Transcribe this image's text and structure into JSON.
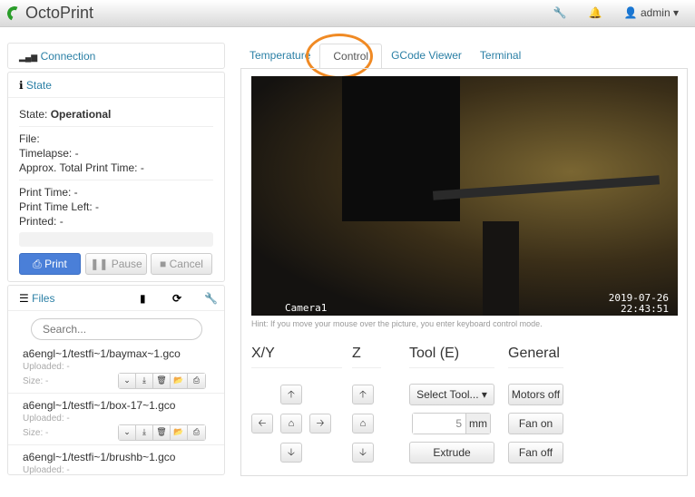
{
  "navbar": {
    "brand": "OctoPrint",
    "user": "admin"
  },
  "sidebar": {
    "connection": "Connection",
    "state": {
      "title": "State",
      "state_label": "State:",
      "state_value": "Operational",
      "file": "File:",
      "timelapse": "Timelapse: -",
      "approx": "Approx. Total Print Time: -",
      "print_time": "Print Time: -",
      "time_left": "Print Time Left: -",
      "printed": "Printed: -",
      "progress": 0,
      "print": "Print",
      "pause": "Pause",
      "cancel": "Cancel"
    },
    "files": {
      "title": "Files",
      "search_placeholder": "Search...",
      "items": [
        {
          "name": "a6engl~1/testfi~1/baymax~1.gco",
          "uploaded": "Uploaded: -",
          "size": "Size: -"
        },
        {
          "name": "a6engl~1/testfi~1/box-17~1.gco",
          "uploaded": "Uploaded: -",
          "size": "Size: -"
        },
        {
          "name": "a6engl~1/testfi~1/brushb~1.gco",
          "uploaded": "Uploaded: -",
          "size": ""
        }
      ]
    }
  },
  "tabs": [
    {
      "label": "Temperature"
    },
    {
      "label": "Control",
      "active": true
    },
    {
      "label": "GCode Viewer"
    },
    {
      "label": "Terminal"
    }
  ],
  "camera": {
    "label": "Camera1",
    "date": "2019-07-26",
    "time": "22:43:51"
  },
  "hint": "Hint: If you move your mouse over the picture, you enter keyboard control mode.",
  "control": {
    "xy": "X/Y",
    "z": "Z",
    "tool": "Tool (E)",
    "general": "General",
    "select_tool": "Select Tool...",
    "amount": "5",
    "unit": "mm",
    "extrude": "Extrude",
    "motors_off": "Motors off",
    "fan_on": "Fan on",
    "fan_off": "Fan off"
  },
  "annotation_color": "#f08a24"
}
